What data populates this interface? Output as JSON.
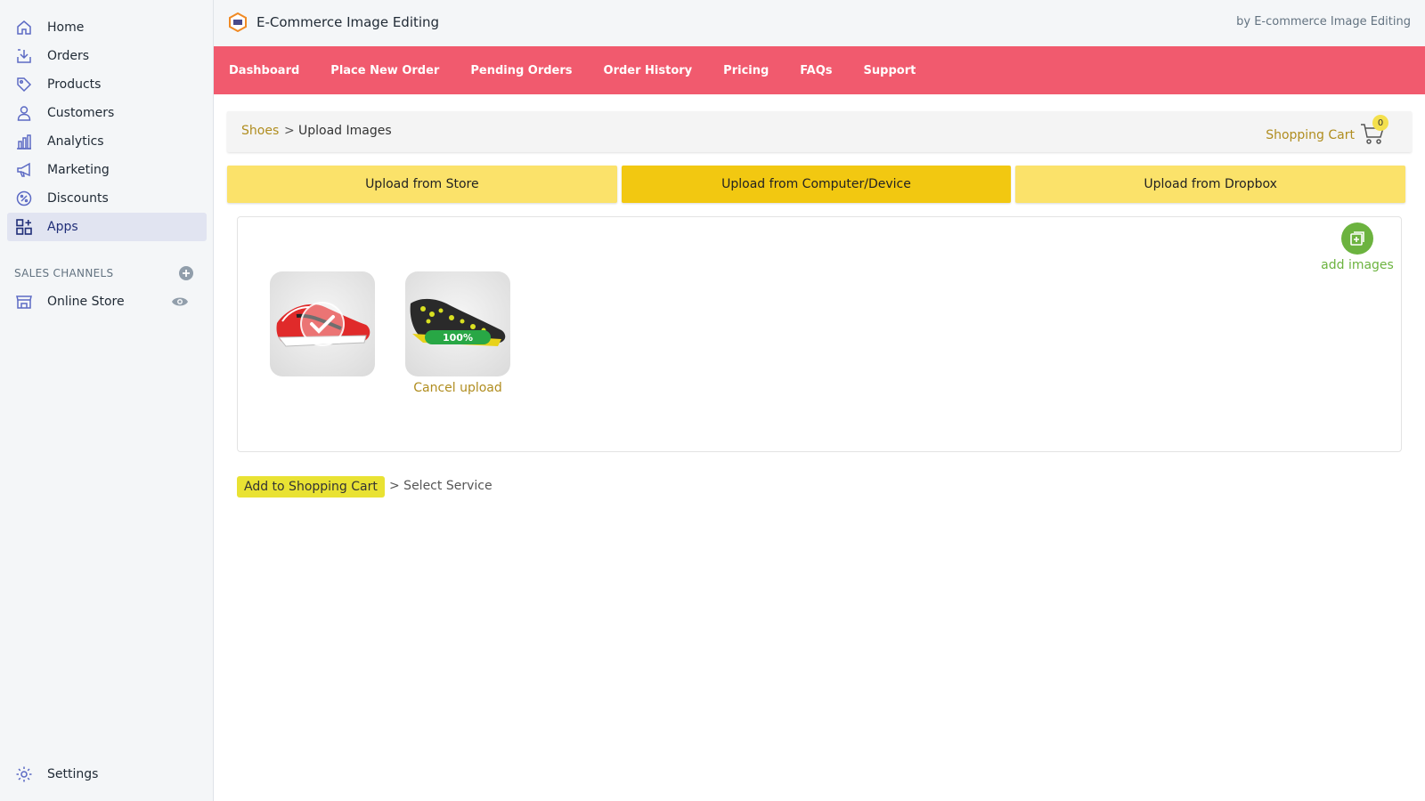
{
  "sidebar": {
    "items": [
      {
        "label": "Home",
        "icon": "home-icon"
      },
      {
        "label": "Orders",
        "icon": "orders-icon"
      },
      {
        "label": "Products",
        "icon": "tag-icon"
      },
      {
        "label": "Customers",
        "icon": "person-icon"
      },
      {
        "label": "Analytics",
        "icon": "bar-chart-icon"
      },
      {
        "label": "Marketing",
        "icon": "megaphone-icon"
      },
      {
        "label": "Discounts",
        "icon": "discount-icon"
      },
      {
        "label": "Apps",
        "icon": "apps-icon",
        "active": true
      }
    ],
    "sales_channels_heading": "SALES CHANNELS",
    "online_store": "Online Store",
    "settings": "Settings"
  },
  "header": {
    "app_title": "E-Commerce Image Editing",
    "by_line": "by E-commerce Image Editing"
  },
  "nav": {
    "items": [
      "Dashboard",
      "Place New Order",
      "Pending Orders",
      "Order History",
      "Pricing",
      "FAQs",
      "Support"
    ]
  },
  "breadcrumb": {
    "parent": "Shoes",
    "separator": ">",
    "current": "Upload Images"
  },
  "cart": {
    "label": "Shopping Cart",
    "count": "0"
  },
  "upload_tabs": {
    "items": [
      "Upload from Store",
      "Upload from Computer/Device",
      "Upload from Dropbox"
    ],
    "active_index": 1
  },
  "upload_area": {
    "add_images_label": "add images",
    "images": [
      {
        "name": "red shoe",
        "status": "uploaded"
      },
      {
        "name": "black yellow shoe",
        "status": "uploading",
        "progress": "100%",
        "cancel_label": "Cancel upload"
      }
    ]
  },
  "actions": {
    "add_to_cart": "Add to Shopping Cart",
    "next_step": "> Select Service"
  },
  "colors": {
    "nav_bg": "#f15a6e",
    "tab_bg": "#fbe26a",
    "tab_active_bg": "#f2c811",
    "link_gold": "#b08d1f",
    "add_green": "#6cb33f",
    "progress_green": "#28a745"
  }
}
